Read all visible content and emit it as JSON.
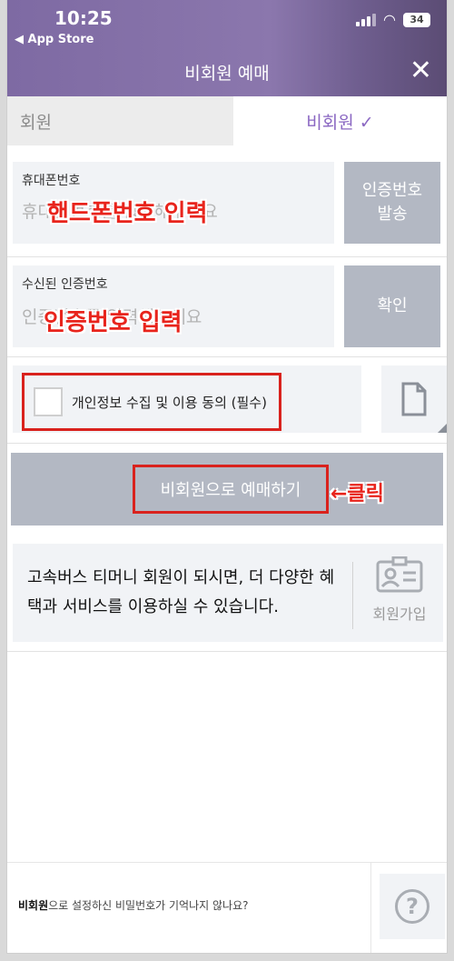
{
  "status": {
    "time": "10:25",
    "back_app": "◀ App Store",
    "battery": "34"
  },
  "header": {
    "title": "비회원 예매",
    "close": "✕"
  },
  "tabs": {
    "member": "회원",
    "guest": "비회원 ✓"
  },
  "phone": {
    "label": "휴대폰번호",
    "placeholder": "휴대폰번호를 입력해주세요",
    "button": "인증번호\n발송",
    "overlay": "핸드폰번호 인력"
  },
  "auth": {
    "label": "수신된 인증번호",
    "placeholder": "인증번호를 입력해주세요",
    "button": "확인",
    "overlay": "인증번호 입력"
  },
  "agree": {
    "label": "개인정보 수집 및 이용 동의 (필수)"
  },
  "main_button": {
    "label": "비회원으로 예매하기"
  },
  "click_note": "←클릭",
  "info": {
    "text": "고속버스 티머니 회원이 되시면, 더 다양한 혜택과 서비스를 이용하실 수 있습니다.",
    "join": "회원가입"
  },
  "footer": {
    "bold": "비회원",
    "text": "으로 설정하신 비밀번호가 기억나지 않나요?",
    "help": "?"
  },
  "colors": {
    "accent": "#8a67c2",
    "button_gray": "#b3b8c3",
    "annotation_red": "#e8241c"
  }
}
